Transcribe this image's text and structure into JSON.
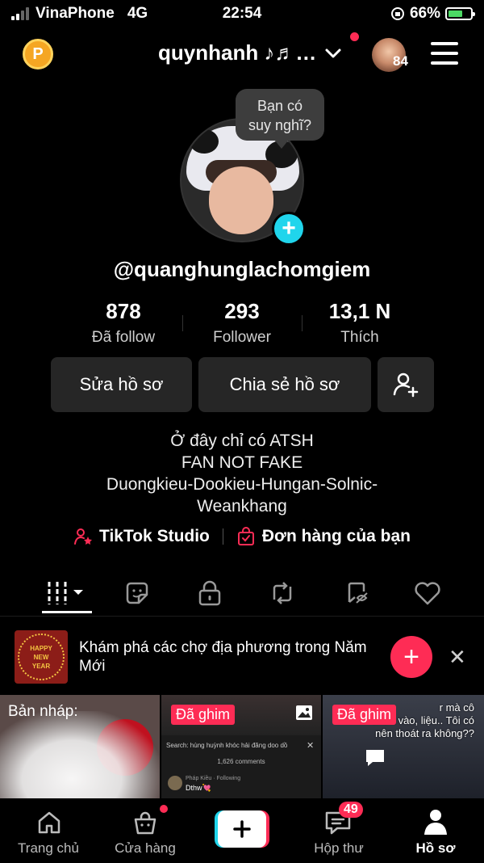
{
  "status_bar": {
    "carrier": "VinaPhone",
    "network": "4G",
    "time": "22:54",
    "battery": "66%",
    "battery_level": 0.66
  },
  "header": {
    "coin_label": "P",
    "username": "quynhanh ♪♬…",
    "notif_count": "84"
  },
  "profile": {
    "thought_bubble": [
      "Bạn có",
      "suy nghĩ?"
    ],
    "handle": "@quanghunglachomgiem",
    "stats": [
      {
        "value": "878",
        "label": "Đã follow"
      },
      {
        "value": "293",
        "label": "Follower"
      },
      {
        "value": "13,1 N",
        "label": "Thích"
      }
    ],
    "buttons": {
      "edit": "Sửa hồ sơ",
      "share": "Chia sẻ hồ sơ"
    },
    "bio": [
      "Ở đây chỉ có ATSH",
      "FAN NOT FAKE",
      "Duongkieu-Dookieu-Hungan-Solnic-",
      "Weankhang"
    ],
    "links": {
      "studio": "TikTok Studio",
      "orders": "Đơn hàng của bạn"
    }
  },
  "tabs": [
    "videos-tab",
    "stickers-tab",
    "private-tab",
    "repost-tab",
    "favorites-tab",
    "liked-tab"
  ],
  "promo": {
    "image_text": [
      "HAPPY",
      "NEW",
      "YEAR"
    ],
    "text": "Khám phá các chợ địa phương trong Năm Mới"
  },
  "grid": {
    "tiles": [
      {
        "label": "Bản nháp:"
      },
      {
        "label": "Đã ghim",
        "search": "Search: hùng huỳnh khóc hải đăng doo dồ",
        "comments": "1,626 comments",
        "commenter": "Pháp Kiều · Following",
        "comment_text": "Dthw💘"
      },
      {
        "label": "Đã ghim",
        "text": [
          "r mà cô",
          "chưa vào, liệu.. Tôi có",
          "nên thoát ra không??"
        ]
      }
    ]
  },
  "bottom_nav": {
    "items": [
      {
        "label": "Trang chủ"
      },
      {
        "label": "Cửa hàng"
      },
      {
        "label": "Hộp thư",
        "badge": "49"
      },
      {
        "label": "Hồ sơ"
      }
    ]
  },
  "colors": {
    "accent": "#fe2c55",
    "cyan": "#20d5ec",
    "background": "#000000"
  }
}
